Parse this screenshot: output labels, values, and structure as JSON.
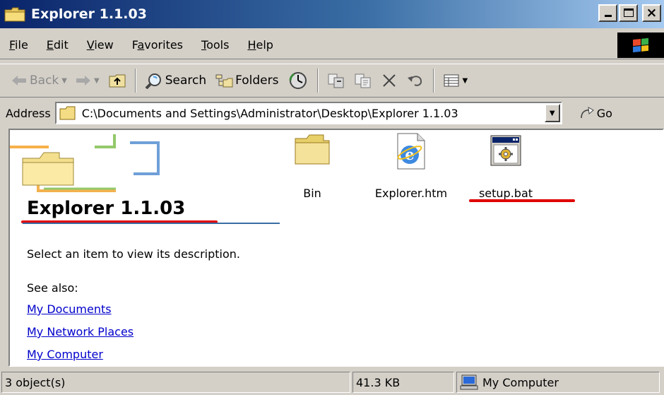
{
  "window": {
    "title": "Explorer 1.1.03"
  },
  "menu": [
    {
      "label": "File",
      "mnemonic_index": 0
    },
    {
      "label": "Edit",
      "mnemonic_index": 0
    },
    {
      "label": "View",
      "mnemonic_index": 0
    },
    {
      "label": "Favorites",
      "mnemonic_index": 1
    },
    {
      "label": "Tools",
      "mnemonic_index": 0
    },
    {
      "label": "Help",
      "mnemonic_index": 0
    }
  ],
  "toolbar": {
    "back_label": "Back",
    "search_label": "Search",
    "folders_label": "Folders"
  },
  "address": {
    "label": "Address",
    "path": "C:\\Documents and Settings\\Administrator\\Desktop\\Explorer 1.1.03",
    "go_label": "Go"
  },
  "webview": {
    "folder_title": "Explorer 1.1.03",
    "description": "Select an item to view its description.",
    "see_also_label": "See also:",
    "links": [
      "My Documents",
      "My Network Places",
      "My Computer"
    ]
  },
  "files": [
    {
      "name": "Bin",
      "icon": "folder-icon"
    },
    {
      "name": "Explorer.htm",
      "icon": "ie-html-file-icon"
    },
    {
      "name": "setup.bat",
      "icon": "batch-file-icon"
    }
  ],
  "status": {
    "objects": "3 object(s)",
    "size": "41.3 KB",
    "zone": "My Computer"
  },
  "colors": {
    "title_gradient_start": "#0a246a",
    "title_gradient_end": "#a6caf0",
    "chrome": "#d4d0c8",
    "link": "#0000cc",
    "annotation_underline": "#e00000"
  }
}
